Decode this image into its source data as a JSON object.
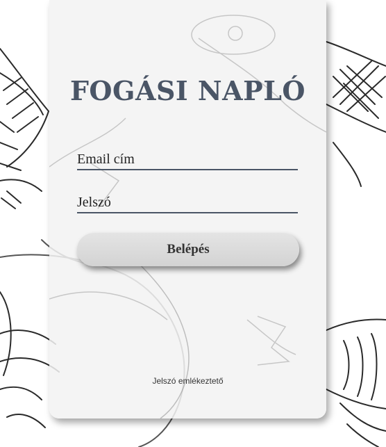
{
  "app": {
    "title": "FOGÁSI NAPLÓ"
  },
  "login": {
    "email_placeholder": "Email cím",
    "email_value": "",
    "password_placeholder": "Jelszó",
    "password_value": "",
    "submit_label": "Belépés",
    "forgot_password_label": "Jelszó emlékeztető"
  },
  "theme": {
    "title_color": "#4a5566",
    "card_background": "#f2f2f2",
    "button_background": "#d9d9d9"
  }
}
